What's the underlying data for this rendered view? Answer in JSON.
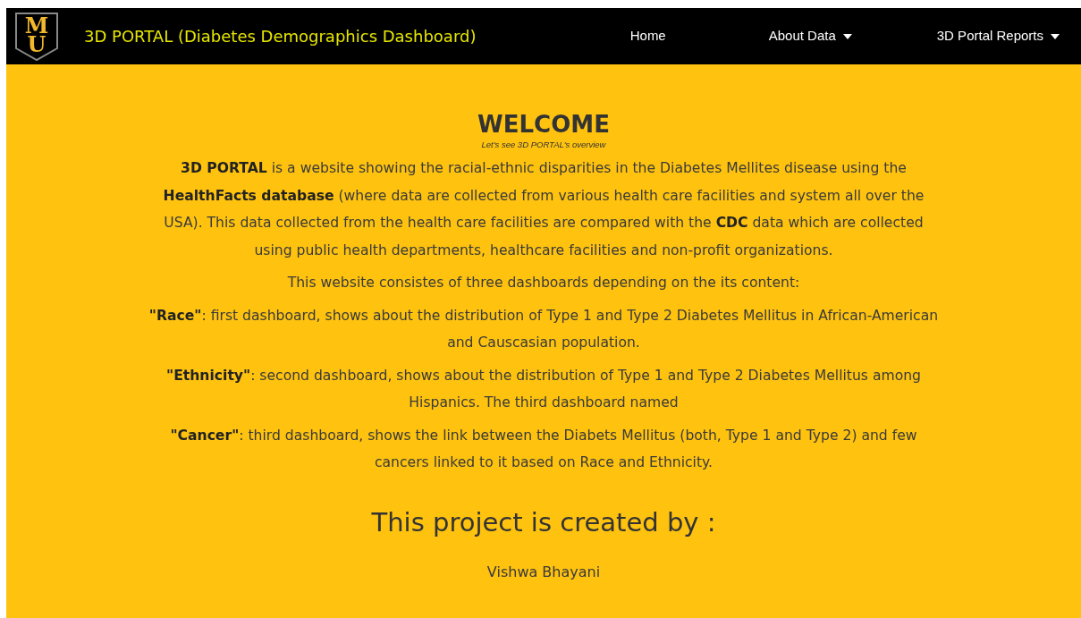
{
  "navbar": {
    "logo_letters": [
      "M",
      "U"
    ],
    "brand": "3D PORTAL (Diabetes Demographics Dashboard)",
    "links": [
      {
        "label": "Home",
        "dropdown": false
      },
      {
        "label": "About Data",
        "dropdown": true
      },
      {
        "label": "3D Portal Reports",
        "dropdown": true
      }
    ]
  },
  "main": {
    "title": "WELCOME",
    "subtitle": "Let's see 3D PORTAL's overview",
    "paragraphs": [
      "**3D PORTAL** is a website showing the racial-ethnic disparities in the Diabetes Mellites disease using the **HealthFacts database** (where data are collected from various health care facilities and system all over the USA). This data collected from the health care facilities are compared with the **CDC** data which are collected using public health departments, healthcare facilities and non-profit organizations.",
      "This website consistes of three dashboards depending on the its content:",
      "**\"Race\"**: first dashboard, shows about the distribution of Type 1 and Type 2 Diabetes Mellitus in African-American and Causcasian population.",
      "**\"Ethnicity\"**: second dashboard, shows about the distribution of Type 1 and Type 2 Diabetes Mellitus among Hispanics. The third dashboard named",
      "**\"Cancer\"**: third dashboard, shows the link between the Diabets Mellitus (both, Type 1 and Type 2) and few cancers linked to it based on Race and Ethnicity."
    ],
    "creators_heading": "This project is created by :",
    "creators": [
      "Vishwa Bhayani"
    ]
  }
}
